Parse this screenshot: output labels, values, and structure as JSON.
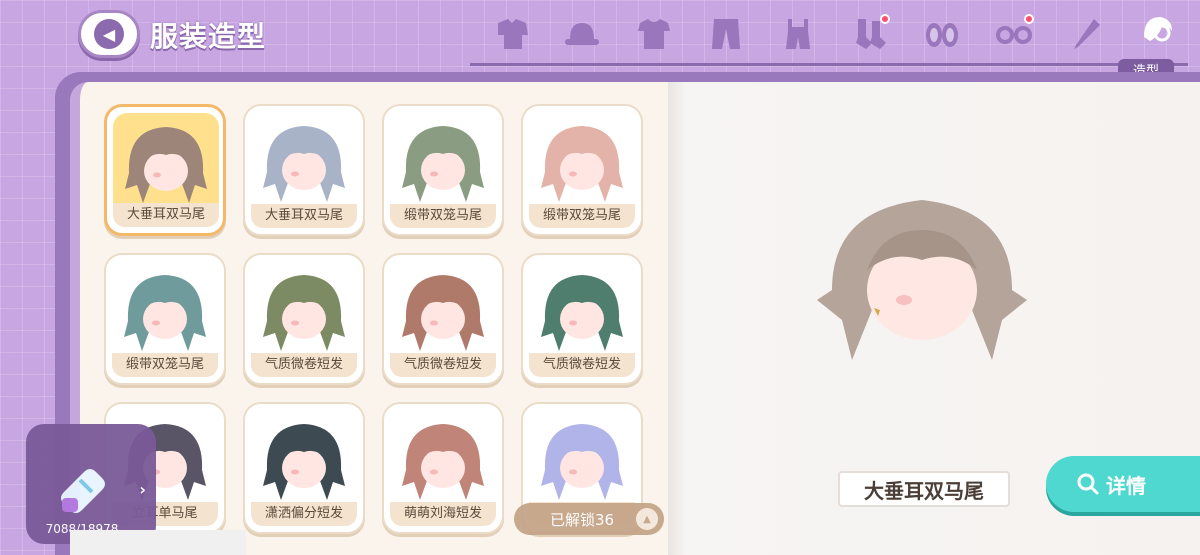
{
  "header": {
    "title": "服装造型",
    "active_category_label": "造型",
    "categories": [
      {
        "icon": "outfit-set-icon",
        "badge": false
      },
      {
        "icon": "hat-icon",
        "badge": false
      },
      {
        "icon": "shirt-icon",
        "badge": false
      },
      {
        "icon": "pants-icon",
        "badge": false
      },
      {
        "icon": "overalls-icon",
        "badge": false
      },
      {
        "icon": "socks-icon",
        "badge": true
      },
      {
        "icon": "shoes-icon",
        "badge": false
      },
      {
        "icon": "glasses-icon",
        "badge": true
      },
      {
        "icon": "umbrella-icon",
        "badge": false
      },
      {
        "icon": "hairstyle-icon",
        "badge": false,
        "active": true
      }
    ]
  },
  "grid": {
    "items": [
      {
        "label": "大垂耳双马尾",
        "color": "#9e857a",
        "selected": true
      },
      {
        "label": "大垂耳双马尾",
        "color": "#a8b3c8",
        "selected": false
      },
      {
        "label": "缎带双笼马尾",
        "color": "#8a9c82",
        "selected": false
      },
      {
        "label": "缎带双笼马尾",
        "color": "#e3b2a8",
        "selected": false
      },
      {
        "label": "缎带双笼马尾",
        "color": "#6f9b9c",
        "selected": false
      },
      {
        "label": "气质微卷短发",
        "color": "#7c8b63",
        "selected": false
      },
      {
        "label": "气质微卷短发",
        "color": "#b07a6a",
        "selected": false
      },
      {
        "label": "气质微卷短发",
        "color": "#4f7e6e",
        "selected": false
      },
      {
        "label": "立耳单马尾",
        "color": "#5a5566",
        "selected": false
      },
      {
        "label": "潇洒偏分短发",
        "color": "#3e4a52",
        "selected": false
      },
      {
        "label": "萌萌刘海短发",
        "color": "#c08478",
        "selected": false
      },
      {
        "label": "",
        "color": "#b0b4e8",
        "selected": false
      }
    ],
    "unlocked_label": "已解锁36"
  },
  "collection": {
    "count": "7088/18978"
  },
  "preview": {
    "name": "大垂耳双马尾",
    "detail_label": "详情"
  }
}
